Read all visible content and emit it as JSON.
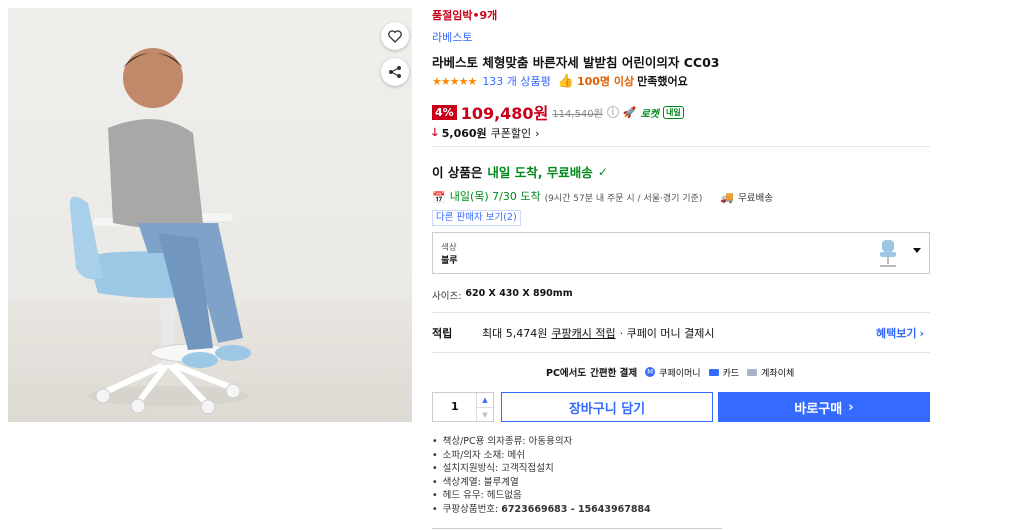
{
  "image": {
    "alt": "",
    "wishlist_icon": "heart-icon",
    "share_icon": "share-icon"
  },
  "product": {
    "sold_badge": "품절임박•9개",
    "brand": "라베스토",
    "title": "라베스토 체형맞춤 바른자세 발받침 어린이의자 CC03",
    "rating": 4.5,
    "review_count": "133 개 상품평",
    "satisfaction_count": "100명 이상",
    "satisfaction_suffix": "만족했어요"
  },
  "price": {
    "discount": "4%",
    "sale": "109,480원",
    "original": "114,540원",
    "rocket_label": "로켓",
    "rocket_badge": "내일",
    "coupon_amount": "5,060원",
    "coupon_label": "쿠폰할인"
  },
  "delivery": {
    "headline_prefix": "이 상품은",
    "headline_highlight": "내일 도착, 무료배송",
    "date": "내일(목) 7/30 도착",
    "date_note": "(9시간 57분 내 주문 시 / 서울·경기 기준)",
    "free_shipping": "무료배송",
    "other_sellers": "다른 판매자 보기(2)"
  },
  "option": {
    "label": "색상",
    "value": "블루"
  },
  "size": {
    "label": "사이즈:",
    "value": "620 X 430 X 890mm"
  },
  "reward": {
    "label": "적립",
    "text_prefix": "최대 5,474원",
    "link": "쿠팡캐시 적립",
    "text_suffix": "· 쿠페이 머니 결제시",
    "benefit_link": "혜택보기"
  },
  "payment": {
    "title_prefix": "PC에서도",
    "title_bold": "간편한 결제",
    "methods": [
      "쿠페이머니",
      "카드",
      "계좌이체"
    ]
  },
  "purchase": {
    "quantity": "1",
    "cart_label": "장바구니 담기",
    "buy_label": "바로구매"
  },
  "specs": [
    "책상/PC용 의자종류: 아동용의자",
    "소파/의자 소재: 메쉬",
    "설치지원방식: 고객직접설치",
    "색상계열: 블루계열",
    "헤드 유무: 헤드없음"
  ],
  "product_number": {
    "label": "쿠팡상품번호:",
    "value": "6723669683 - 15643967884"
  },
  "colors": {
    "accent": "#346aff",
    "price_red": "#c9001a",
    "rocket_green": "#00891a"
  }
}
